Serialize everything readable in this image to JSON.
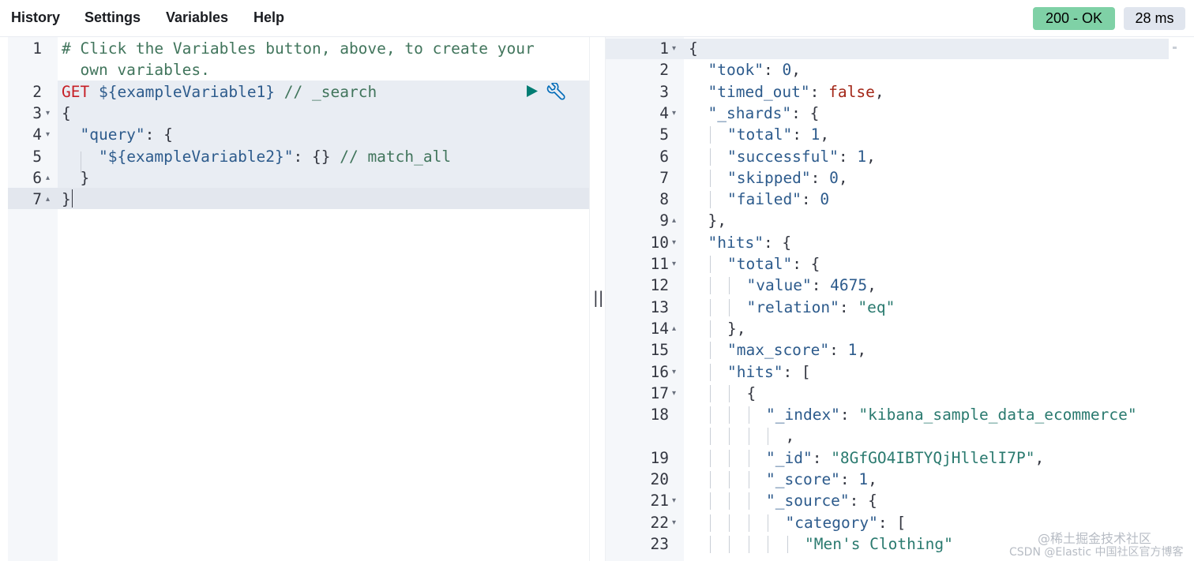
{
  "menu": {
    "history": "History",
    "settings": "Settings",
    "variables": "Variables",
    "help": "Help"
  },
  "status": {
    "code_text": "200 - OK",
    "time_text": "28 ms",
    "ok_color": "#7fd1a6"
  },
  "request_editor": {
    "lines": [
      {
        "num": "1",
        "fold": "",
        "segments": [
          {
            "t": "# Click the Variables button, above, to create your",
            "c": "comment"
          }
        ]
      },
      {
        "num": "",
        "fold": "",
        "segments": [
          {
            "t": "  own variables.",
            "c": "comment"
          }
        ]
      },
      {
        "num": "2",
        "fold": "",
        "segments": [
          {
            "t": "GET",
            "c": "method"
          },
          {
            "t": " ${exampleVariable1}",
            "c": "url"
          },
          {
            "t": " // _search",
            "c": "comment"
          }
        ]
      },
      {
        "num": "3",
        "fold": "▾",
        "segments": [
          {
            "t": "{",
            "c": "punc"
          }
        ]
      },
      {
        "num": "4",
        "fold": "▾",
        "segments": [
          {
            "t": "  ",
            "c": "punc"
          },
          {
            "t": "\"query\"",
            "c": "key"
          },
          {
            "t": ": {",
            "c": "punc"
          }
        ]
      },
      {
        "num": "5",
        "fold": "",
        "segments": [
          {
            "t": "    ",
            "c": "punc"
          },
          {
            "t": "\"${exampleVariable2}\"",
            "c": "key"
          },
          {
            "t": ": {} ",
            "c": "punc"
          },
          {
            "t": "// match_all",
            "c": "comment"
          }
        ]
      },
      {
        "num": "6",
        "fold": "▴",
        "segments": [
          {
            "t": "  }",
            "c": "punc"
          }
        ]
      },
      {
        "num": "7",
        "fold": "▴",
        "segments": [
          {
            "t": "}",
            "c": "punc"
          }
        ]
      }
    ]
  },
  "response_viewer": {
    "lines": [
      {
        "num": "1",
        "fold": "▾",
        "indent": 0,
        "segments": [
          {
            "t": "{",
            "c": "punc"
          }
        ]
      },
      {
        "num": "2",
        "fold": "",
        "indent": 1,
        "segments": [
          {
            "t": "\"took\"",
            "c": "key"
          },
          {
            "t": ": ",
            "c": "punc"
          },
          {
            "t": "0",
            "c": "num"
          },
          {
            "t": ",",
            "c": "punc"
          }
        ]
      },
      {
        "num": "3",
        "fold": "",
        "indent": 1,
        "segments": [
          {
            "t": "\"timed_out\"",
            "c": "key"
          },
          {
            "t": ": ",
            "c": "punc"
          },
          {
            "t": "false",
            "c": "bool"
          },
          {
            "t": ",",
            "c": "punc"
          }
        ]
      },
      {
        "num": "4",
        "fold": "▾",
        "indent": 1,
        "segments": [
          {
            "t": "\"_shards\"",
            "c": "key"
          },
          {
            "t": ": {",
            "c": "punc"
          }
        ]
      },
      {
        "num": "5",
        "fold": "",
        "indent": 2,
        "segments": [
          {
            "t": "\"total\"",
            "c": "key"
          },
          {
            "t": ": ",
            "c": "punc"
          },
          {
            "t": "1",
            "c": "num"
          },
          {
            "t": ",",
            "c": "punc"
          }
        ]
      },
      {
        "num": "6",
        "fold": "",
        "indent": 2,
        "segments": [
          {
            "t": "\"successful\"",
            "c": "key"
          },
          {
            "t": ": ",
            "c": "punc"
          },
          {
            "t": "1",
            "c": "num"
          },
          {
            "t": ",",
            "c": "punc"
          }
        ]
      },
      {
        "num": "7",
        "fold": "",
        "indent": 2,
        "segments": [
          {
            "t": "\"skipped\"",
            "c": "key"
          },
          {
            "t": ": ",
            "c": "punc"
          },
          {
            "t": "0",
            "c": "num"
          },
          {
            "t": ",",
            "c": "punc"
          }
        ]
      },
      {
        "num": "8",
        "fold": "",
        "indent": 2,
        "segments": [
          {
            "t": "\"failed\"",
            "c": "key"
          },
          {
            "t": ": ",
            "c": "punc"
          },
          {
            "t": "0",
            "c": "num"
          }
        ]
      },
      {
        "num": "9",
        "fold": "▴",
        "indent": 1,
        "segments": [
          {
            "t": "},",
            "c": "punc"
          }
        ]
      },
      {
        "num": "10",
        "fold": "▾",
        "indent": 1,
        "segments": [
          {
            "t": "\"hits\"",
            "c": "key"
          },
          {
            "t": ": {",
            "c": "punc"
          }
        ]
      },
      {
        "num": "11",
        "fold": "▾",
        "indent": 2,
        "segments": [
          {
            "t": "\"total\"",
            "c": "key"
          },
          {
            "t": ": {",
            "c": "punc"
          }
        ]
      },
      {
        "num": "12",
        "fold": "",
        "indent": 3,
        "segments": [
          {
            "t": "\"value\"",
            "c": "key"
          },
          {
            "t": ": ",
            "c": "punc"
          },
          {
            "t": "4675",
            "c": "num"
          },
          {
            "t": ",",
            "c": "punc"
          }
        ]
      },
      {
        "num": "13",
        "fold": "",
        "indent": 3,
        "segments": [
          {
            "t": "\"relation\"",
            "c": "key"
          },
          {
            "t": ": ",
            "c": "punc"
          },
          {
            "t": "\"eq\"",
            "c": "str"
          }
        ]
      },
      {
        "num": "14",
        "fold": "▴",
        "indent": 2,
        "segments": [
          {
            "t": "},",
            "c": "punc"
          }
        ]
      },
      {
        "num": "15",
        "fold": "",
        "indent": 2,
        "segments": [
          {
            "t": "\"max_score\"",
            "c": "key"
          },
          {
            "t": ": ",
            "c": "punc"
          },
          {
            "t": "1",
            "c": "num"
          },
          {
            "t": ",",
            "c": "punc"
          }
        ]
      },
      {
        "num": "16",
        "fold": "▾",
        "indent": 2,
        "segments": [
          {
            "t": "\"hits\"",
            "c": "key"
          },
          {
            "t": ": [",
            "c": "punc"
          }
        ]
      },
      {
        "num": "17",
        "fold": "▾",
        "indent": 3,
        "segments": [
          {
            "t": "{",
            "c": "punc"
          }
        ]
      },
      {
        "num": "18",
        "fold": "",
        "indent": 4,
        "segments": [
          {
            "t": "\"_index\"",
            "c": "key"
          },
          {
            "t": ": ",
            "c": "punc"
          },
          {
            "t": "\"kibana_sample_data_ecommerce\"",
            "c": "str"
          }
        ]
      },
      {
        "num": "",
        "fold": "",
        "indent": 5,
        "segments": [
          {
            "t": ",",
            "c": "punc"
          }
        ]
      },
      {
        "num": "19",
        "fold": "",
        "indent": 4,
        "segments": [
          {
            "t": "\"_id\"",
            "c": "key"
          },
          {
            "t": ": ",
            "c": "punc"
          },
          {
            "t": "\"8GfGO4IBTYQjHllelI7P\"",
            "c": "str"
          },
          {
            "t": ",",
            "c": "punc"
          }
        ]
      },
      {
        "num": "20",
        "fold": "",
        "indent": 4,
        "segments": [
          {
            "t": "\"_score\"",
            "c": "key"
          },
          {
            "t": ": ",
            "c": "punc"
          },
          {
            "t": "1",
            "c": "num"
          },
          {
            "t": ",",
            "c": "punc"
          }
        ]
      },
      {
        "num": "21",
        "fold": "▾",
        "indent": 4,
        "segments": [
          {
            "t": "\"_source\"",
            "c": "key"
          },
          {
            "t": ": {",
            "c": "punc"
          }
        ]
      },
      {
        "num": "22",
        "fold": "▾",
        "indent": 5,
        "segments": [
          {
            "t": "\"category\"",
            "c": "key"
          },
          {
            "t": ": [",
            "c": "punc"
          }
        ]
      },
      {
        "num": "23",
        "fold": "",
        "indent": 6,
        "segments": [
          {
            "t": "\"Men's Clothing\"",
            "c": "str"
          }
        ]
      }
    ]
  },
  "resizer": {
    "glyph": "||"
  },
  "watermark": {
    "line1": "@稀土掘金技术社区",
    "line2": "CSDN @Elastic 中国社区官方博客"
  }
}
